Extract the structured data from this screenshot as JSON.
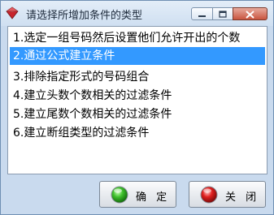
{
  "window": {
    "title": "请选择所增加条件的类型"
  },
  "icons": {
    "app": "red-diamond-app-icon",
    "minimize": "minimize-icon",
    "maximize": "maximize-icon",
    "close": "close-icon",
    "ok": "green-orb-icon",
    "close_button": "red-orb-icon"
  },
  "list": {
    "items": [
      {
        "label": "1.选定一组号码然后设置他们允许开出的个数",
        "selected": false
      },
      {
        "label": "2.通过公式建立条件",
        "selected": true
      },
      {
        "label": "3.排除指定形式的号码组合",
        "selected": false
      },
      {
        "label": "4.建立头数个数相关的过滤条件",
        "selected": false
      },
      {
        "label": "5.建立尾数个数相关的过滤条件",
        "selected": false
      },
      {
        "label": "6.建立断组类型的过滤条件",
        "selected": false
      }
    ]
  },
  "buttons": {
    "ok_label": "确 定",
    "close_label": "关 闭"
  },
  "colors": {
    "selection": "#3399ff",
    "frame": "#c9daee",
    "close_button": "#c9553f"
  }
}
